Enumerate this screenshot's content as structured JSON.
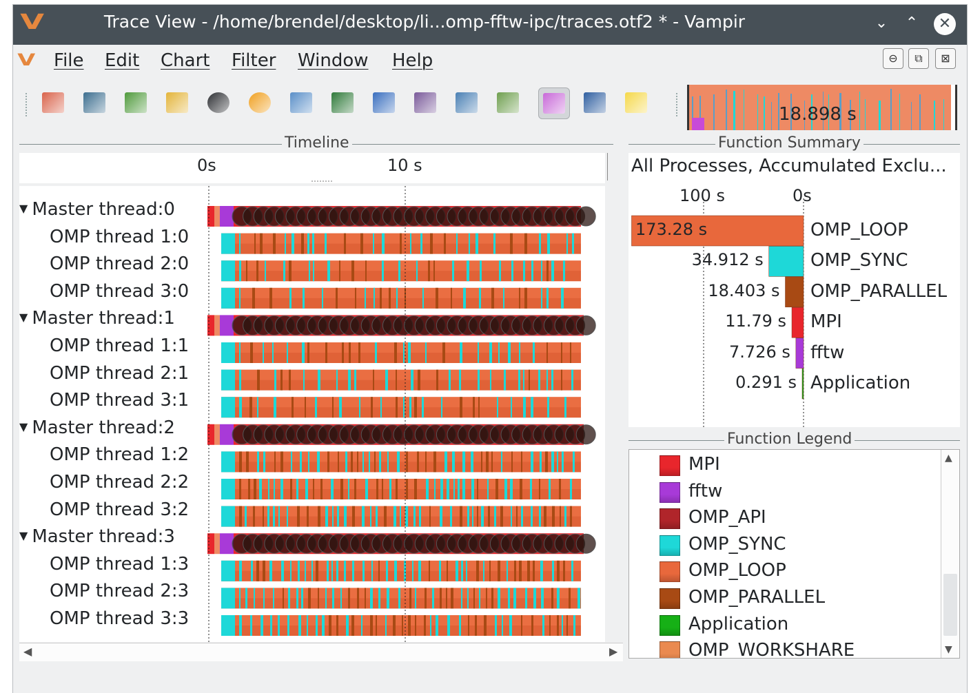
{
  "window": {
    "title": "Trace View - /home/brendel/desktop/li...omp-fftw-ipc/traces.otf2 * - Vampir",
    "logo": "V",
    "minimize_icon": "⌄",
    "maximize_icon": "⌃",
    "close_icon": "✕"
  },
  "menu": [
    "File",
    "Edit",
    "Chart",
    "Filter",
    "Window",
    "Help"
  ],
  "mdi_buttons": [
    "⊖",
    "⧉",
    "⊠"
  ],
  "toolbar": {
    "tools": [
      {
        "icon": "master-timeline-icon",
        "color": "#d9634b"
      },
      {
        "icon": "process-timeline-icon",
        "color": "#3c6e8f"
      },
      {
        "icon": "counter-timeline-icon",
        "color": "#4f9a3c"
      },
      {
        "icon": "performance-radar-icon",
        "color": "#e3b43a"
      },
      {
        "icon": "function-summary-icon",
        "color": "#2d2f33"
      },
      {
        "icon": "pie-chart-icon",
        "color": "#f0a020"
      },
      {
        "icon": "message-summary-icon",
        "color": "#5a8fc8"
      },
      {
        "icon": "communication-matrix-icon",
        "color": "#2f7a3a"
      },
      {
        "icon": "io-summary-icon",
        "color": "#3a6fbf"
      },
      {
        "icon": "call-tree-icon",
        "color": "#7a5a9a"
      },
      {
        "icon": "context-view-icon",
        "color": "#4a80b4"
      },
      {
        "icon": "marker-view-icon",
        "color": "#6f9f4f"
      },
      {
        "icon": "function-legend-icon",
        "color": "#c86ad8",
        "active": true
      },
      {
        "icon": "pin-icon",
        "color": "#2f5fa0"
      },
      {
        "icon": "lightbulb-icon",
        "color": "#f5d84a"
      }
    ],
    "overview_label": "18.898 s"
  },
  "timeline": {
    "panel_title": "Timeline",
    "ticks": [
      "0s",
      "10 s"
    ],
    "rows": [
      {
        "label": "Master thread:0",
        "master": true
      },
      {
        "label": "OMP thread 1:0",
        "master": false
      },
      {
        "label": "OMP thread 2:0",
        "master": false
      },
      {
        "label": "OMP thread 3:0",
        "master": false
      },
      {
        "label": "Master thread:1",
        "master": true
      },
      {
        "label": "OMP thread 1:1",
        "master": false
      },
      {
        "label": "OMP thread 2:1",
        "master": false
      },
      {
        "label": "OMP thread 3:1",
        "master": false
      },
      {
        "label": "Master thread:2",
        "master": true
      },
      {
        "label": "OMP thread 1:2",
        "master": false
      },
      {
        "label": "OMP thread 2:2",
        "master": false
      },
      {
        "label": "OMP thread 3:2",
        "master": false
      },
      {
        "label": "Master thread:3",
        "master": true
      },
      {
        "label": "OMP thread 1:3",
        "master": false
      },
      {
        "label": "OMP thread 2:3",
        "master": false
      },
      {
        "label": "OMP thread 3:3",
        "master": false
      }
    ],
    "expand_icon": "▼"
  },
  "function_summary": {
    "panel_title": "Function Summary",
    "header": "All Processes, Accumulated Exclu...",
    "axis_left": "100 s",
    "axis_right": "0s",
    "bars": [
      {
        "name": "OMP_LOOP",
        "value_label": "173.28 s",
        "value": 173.28,
        "color": "#e8683c"
      },
      {
        "name": "OMP_SYNC",
        "value_label": "34.912 s",
        "value": 34.912,
        "color": "#1ed8d8"
      },
      {
        "name": "OMP_PARALLEL",
        "value_label": "18.403 s",
        "value": 18.403,
        "color": "#a84a14"
      },
      {
        "name": "MPI",
        "value_label": "11.79 s",
        "value": 11.79,
        "color": "#e8262c"
      },
      {
        "name": "fftw",
        "value_label": "7.726 s",
        "value": 7.726,
        "color": "#a83ad8"
      },
      {
        "name": "Application",
        "value_label": "0.291 s",
        "value": 0.291,
        "color": "#1aa81a"
      }
    ]
  },
  "function_legend": {
    "panel_title": "Function Legend",
    "items": [
      {
        "name": "MPI",
        "color": "#e8262c"
      },
      {
        "name": "fftw",
        "color": "#a83ad8"
      },
      {
        "name": "OMP_API",
        "color": "#b0252a"
      },
      {
        "name": "OMP_SYNC",
        "color": "#1ed8d8"
      },
      {
        "name": "OMP_LOOP",
        "color": "#e8683c"
      },
      {
        "name": "OMP_PARALLEL",
        "color": "#a84a14"
      },
      {
        "name": "Application",
        "color": "#16b016"
      },
      {
        "name": "OMP_WORKSHARE",
        "color": "#ea8a50"
      }
    ]
  }
}
